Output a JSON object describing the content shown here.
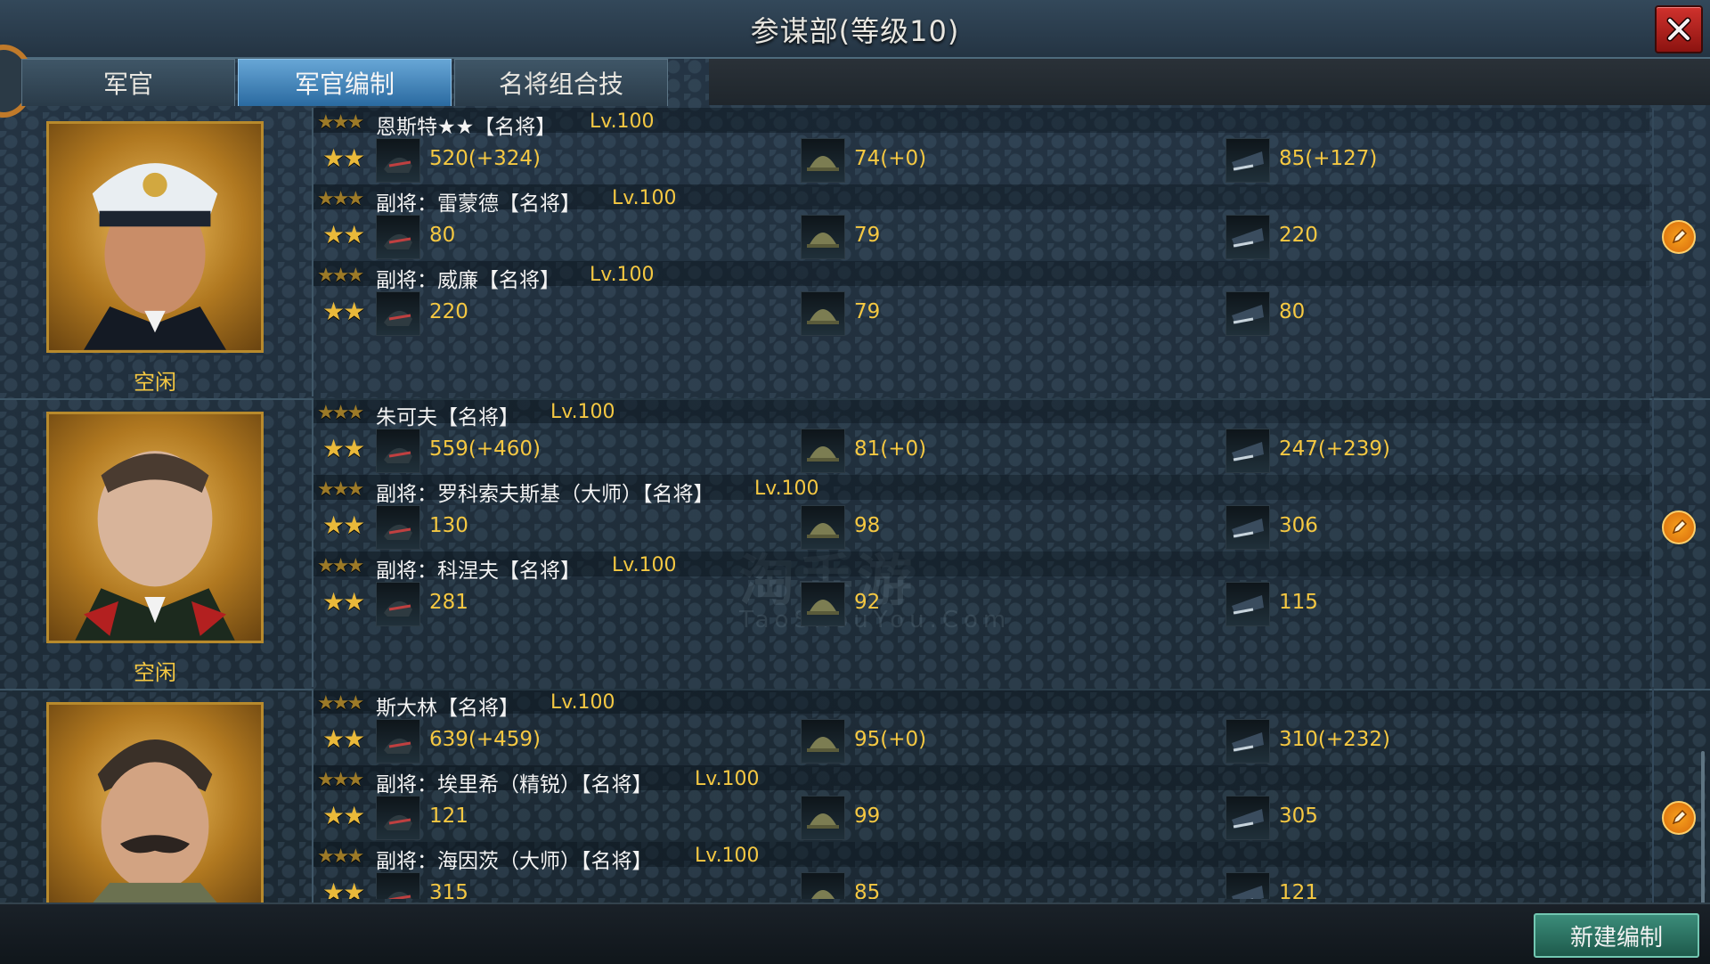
{
  "header": {
    "title": "参谋部(等级10)"
  },
  "tabs": [
    {
      "label": "军官",
      "active": false
    },
    {
      "label": "军官编制",
      "active": true
    },
    {
      "label": "名将组合技",
      "active": false
    }
  ],
  "icons": {
    "close": "close-icon",
    "attack": "attack-icon",
    "defense": "helmet-icon",
    "command": "cap-icon",
    "edit": "edit-icon",
    "settings": "gear-icon"
  },
  "formations": [
    {
      "status": "空闲",
      "officers": [
        {
          "stars3": "★★★",
          "stars2": "★★",
          "name": "恩斯特★★【名将】",
          "level": "Lv.100",
          "attack": "520(+324)",
          "defense": "74(+0)",
          "command": "85(+127)"
        },
        {
          "stars3": "★★★",
          "stars2": "★★",
          "name": "副将：雷蒙德【名将】",
          "level": "Lv.100",
          "attack": "80",
          "defense": "79",
          "command": "220"
        },
        {
          "stars3": "★★★",
          "stars2": "★★",
          "name": "副将：威廉【名将】",
          "level": "Lv.100",
          "attack": "220",
          "defense": "79",
          "command": "80"
        }
      ]
    },
    {
      "status": "空闲",
      "officers": [
        {
          "stars3": "★★★",
          "stars2": "★★",
          "name": "朱可夫【名将】",
          "level": "Lv.100",
          "attack": "559(+460)",
          "defense": "81(+0)",
          "command": "247(+239)"
        },
        {
          "stars3": "★★★",
          "stars2": "★★",
          "name": "副将：罗科索夫斯基（大师）【名将】",
          "level": "Lv.100",
          "attack": "130",
          "defense": "98",
          "command": "306"
        },
        {
          "stars3": "★★★",
          "stars2": "★★",
          "name": "副将：科涅夫【名将】",
          "level": "Lv.100",
          "attack": "281",
          "defense": "92",
          "command": "115"
        }
      ]
    },
    {
      "status": "",
      "officers": [
        {
          "stars3": "★★★",
          "stars2": "★★",
          "name": "斯大林【名将】",
          "level": "Lv.100",
          "attack": "639(+459)",
          "defense": "95(+0)",
          "command": "310(+232)"
        },
        {
          "stars3": "★★★",
          "stars2": "★★",
          "name": "副将：埃里希（精锐）【名将】",
          "level": "Lv.100",
          "attack": "121",
          "defense": "99",
          "command": "305"
        },
        {
          "stars3": "★★★",
          "stars2": "★★",
          "name": "副将：海因茨（大师）【名将】",
          "level": "Lv.100",
          "attack": "315",
          "defense": "85",
          "command": "121"
        }
      ]
    }
  ],
  "watermark": {
    "main": "淘手游",
    "sub": "TaoShouYou.Com"
  },
  "footer": {
    "new_button": "新建编制"
  }
}
